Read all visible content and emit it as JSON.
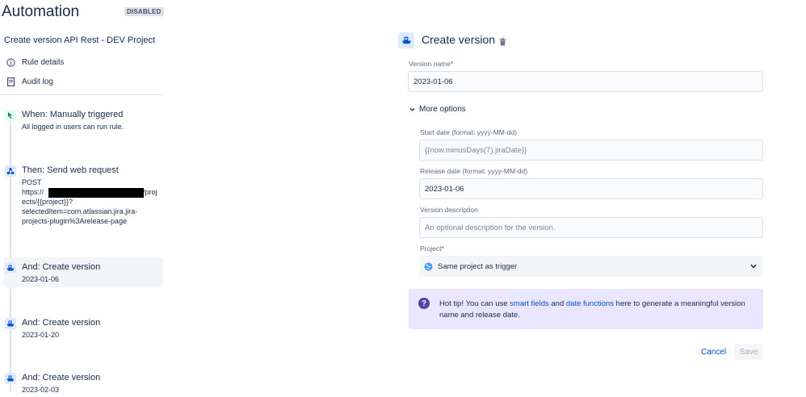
{
  "header": {
    "app_title": "Automation",
    "status": "DISABLED",
    "rule_name": "Create version API Rest - DEV Project"
  },
  "nav": {
    "items": [
      {
        "label": "Rule details",
        "icon": "info-icon"
      },
      {
        "label": "Audit log",
        "icon": "document-icon"
      }
    ]
  },
  "components": [
    {
      "title": "When: Manually triggered",
      "lines": [
        "All logged in users can run rule."
      ],
      "icon": "trigger-hand-icon"
    },
    {
      "title": "Then: Send web request",
      "lines": [
        "POST",
        "https://",
        "/proj",
        "ects/{{project}}?",
        "selectedItem=com.atlassian.jira.jira-",
        "projects-plugin%3Arelease-page"
      ],
      "icon": "webhook-icon"
    },
    {
      "title": "And: Create version",
      "lines": [
        "2023-01-06"
      ],
      "icon": "ship-icon"
    },
    {
      "title": "And: Create version",
      "lines": [
        "2023-01-20"
      ],
      "icon": "ship-icon"
    },
    {
      "title": "And: Create version",
      "lines": [
        "2023-02-03"
      ],
      "icon": "ship-icon"
    }
  ],
  "panel": {
    "title": "Create version",
    "version_name": {
      "label": "Version name",
      "required": "*",
      "value": "2023-01-06"
    },
    "more_options": "More options",
    "start_date": {
      "label": "Start date (format: yyyy-MM-dd)",
      "value": "{{now.minusDays(7).jiraDate}}"
    },
    "release_date": {
      "label": "Release date (format: yyyy-MM-dd)",
      "value": "2023-01-06"
    },
    "description": {
      "label": "Version description",
      "placeholder": "An optional description for the version."
    },
    "project": {
      "label": "Project",
      "required": "*",
      "value": "Same project as trigger"
    },
    "tip": {
      "part1": "Hot tip! You can use ",
      "link1": "smart fields",
      "part2": " and ",
      "link2": "date functions",
      "part3": " here to generate a meaningful version name and release date."
    },
    "cancel_label": "Cancel",
    "save_label": "Save"
  },
  "colors": {
    "accent": "#0052cc",
    "tip_background": "#eae6ff",
    "trigger": "#00875a"
  }
}
